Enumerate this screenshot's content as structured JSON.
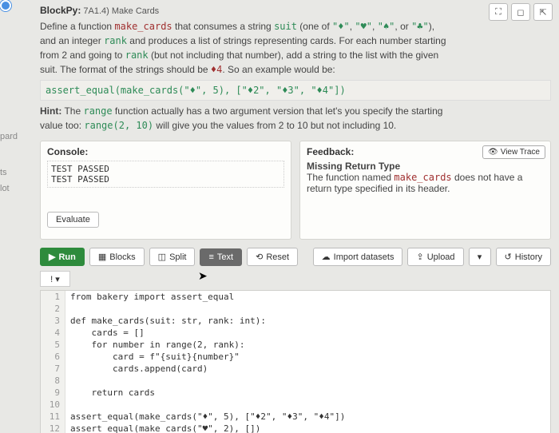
{
  "header": {
    "prefix": "BlockPy:",
    "breadcrumb": "7A1.4) Make Cards"
  },
  "desc": {
    "p1a": "Define a function ",
    "fn": "make_cards",
    "p1b": " that consumes a string ",
    "suit": "suit",
    "p1c": " (one of ",
    "s1": "\"♦\"",
    "s2": "\"♥\"",
    "s3": "\"♠\"",
    "or": ", or ",
    "s4": "\"♣\"",
    "p1d": "),",
    "p2a": "and an integer ",
    "rank": "rank",
    "p2b": " and produces a list of strings representing cards. For each number starting",
    "p3a": "from 2 and going to ",
    "p3b": " (but not including that number), add a string to the list with the given",
    "p4a": "suit. The format of the strings should be ",
    "fmt": "♦4",
    "p4b": ". So an example would be:",
    "code": "assert_equal(make_cards(\"♦\", 5), [\"♦2\", \"♦3\", \"♦4\"])",
    "hint_a": "Hint: The ",
    "range": "range",
    "hint_b": " function actually has a two argument version that let's you specify the starting",
    "hint_c": "value too: ",
    "range_ex": "range(2, 10)",
    "hint_d": " will give you the values from 2 to 10 but not including 10."
  },
  "left": {
    "t1": "pard",
    "t2": "ts",
    "t3": "lot"
  },
  "console": {
    "title": "Console:",
    "l1": "TEST PASSED",
    "l2": "TEST PASSED",
    "evaluate": "Evaluate"
  },
  "feedback": {
    "title": "Feedback:",
    "subtitle": "Missing Return Type",
    "msg_a": "The function named ",
    "msg_fn": "make_cards",
    "msg_b": " does not have a return type specified in its header.",
    "view_trace": "View Trace"
  },
  "toolbar": {
    "run": "Run",
    "blocks": "Blocks",
    "split": "Split",
    "text": "Text",
    "reset": "Reset",
    "import": "Import datasets",
    "upload": "Upload",
    "history": "History"
  },
  "mini": {
    "label": "! ▾"
  },
  "code": {
    "l1": "from bakery import assert_equal",
    "l2": "",
    "l3": "def make_cards(suit: str, rank: int):",
    "l4": "    cards = []",
    "l5": "    for number in range(2, rank):",
    "l6": "        card = f\"{suit}{number}\"",
    "l7": "        cards.append(card)",
    "l8": "",
    "l9": "    return cards",
    "l10": "",
    "l11": "assert_equal(make_cards(\"♦\", 5), [\"♦2\", \"♦3\", \"♦4\"])",
    "l12": "assert_equal(make_cards(\"♥\", 2), [])"
  },
  "lines": [
    "1",
    "2",
    "3",
    "4",
    "5",
    "6",
    "7",
    "8",
    "9",
    "10",
    "11",
    "12"
  ]
}
